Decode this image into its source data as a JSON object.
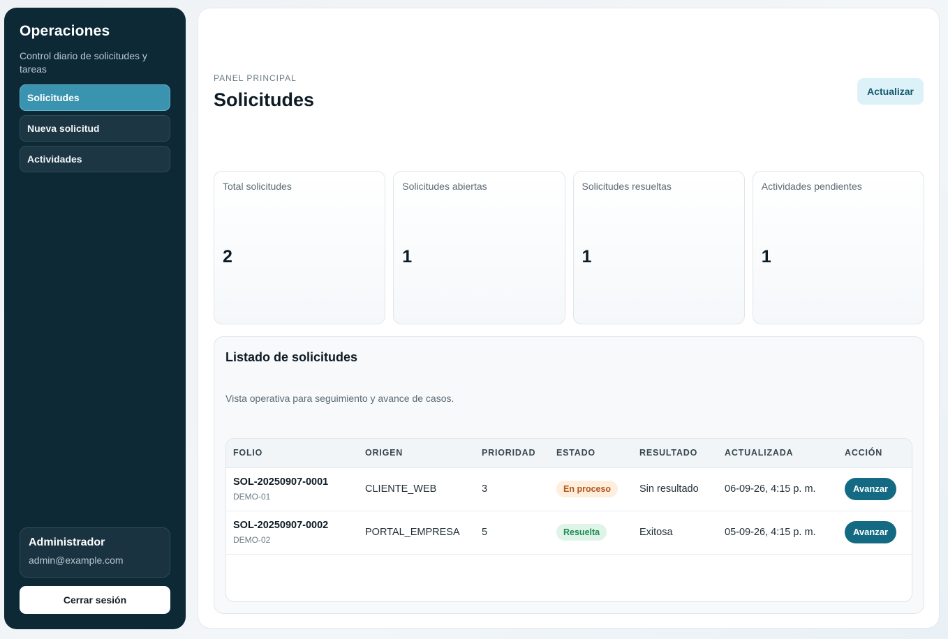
{
  "sidebar": {
    "title": "Operaciones",
    "subtitle": "Control diario de solicitudes y tareas",
    "nav": [
      {
        "label": "Solicitudes",
        "active": true
      },
      {
        "label": "Nueva solicitud",
        "active": false
      },
      {
        "label": "Actividades",
        "active": false
      }
    ],
    "user": {
      "name": "Administrador",
      "email": "admin@example.com"
    },
    "logout_label": "Cerrar sesión"
  },
  "header": {
    "eyebrow": "PANEL PRINCIPAL",
    "title": "Solicitudes",
    "refresh_label": "Actualizar"
  },
  "stats": [
    {
      "label": "Total solicitudes",
      "value": "2"
    },
    {
      "label": "Solicitudes abiertas",
      "value": "1"
    },
    {
      "label": "Solicitudes resueltas",
      "value": "1"
    },
    {
      "label": "Actividades pendientes",
      "value": "1"
    }
  ],
  "list": {
    "title": "Listado de solicitudes",
    "subtitle": "Vista operativa para seguimiento y avance de casos.",
    "columns": [
      "FOLIO",
      "ORIGEN",
      "PRIORIDAD",
      "ESTADO",
      "RESULTADO",
      "ACTUALIZADA",
      "ACCIÓN"
    ],
    "rows": [
      {
        "folio": "SOL-20250907-0001",
        "code": "DEMO-01",
        "origen": "CLIENTE_WEB",
        "prioridad": "3",
        "estado": "En proceso",
        "resultado": "Sin resultado",
        "actualizada": "06-09-26, 4:15 p. m.",
        "accion": "Avanzar"
      },
      {
        "folio": "SOL-20250907-0002",
        "code": "DEMO-02",
        "origen": "PORTAL_EMPRESA",
        "prioridad": "5",
        "estado": "Resuelta",
        "resultado": "Exitosa",
        "actualizada": "05-09-26, 4:15 p. m.",
        "accion": "Avanzar"
      }
    ]
  },
  "colors": {
    "sidebar_bg": "#0e2936",
    "nav_active": "#3a94b0",
    "primary_button": "#146a82",
    "badge_proceso": "#fdeede",
    "badge_resuelta": "#dff4e8"
  }
}
